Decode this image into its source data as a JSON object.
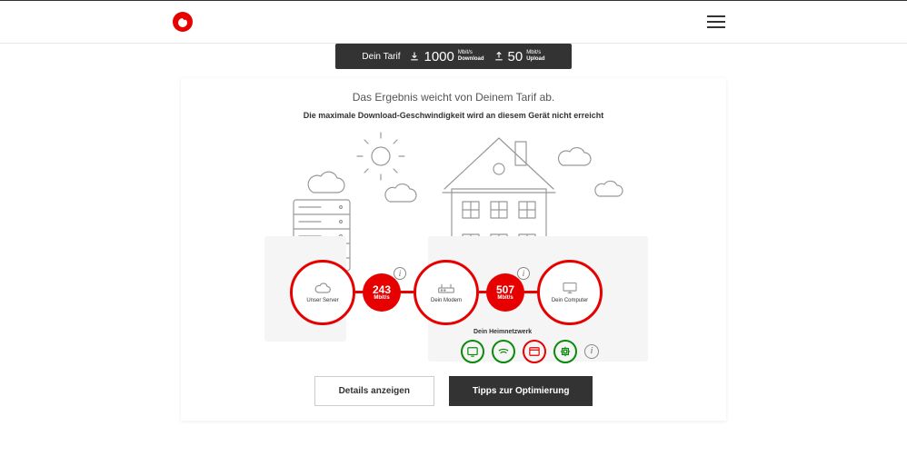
{
  "header": {
    "brand": "Vodafone"
  },
  "tarif": {
    "label": "Dein Tarif",
    "download_value": "1000",
    "download_unit": "Mbit/s",
    "download_label": "Download",
    "upload_value": "50",
    "upload_unit": "Mbit/s",
    "upload_label": "Upload"
  },
  "result": {
    "title": "Das Ergebnis weicht von Deinem Tarif ab.",
    "subtitle": "Die maximale Download-Geschwindigkeit wird an diesem Gerät nicht erreicht"
  },
  "nodes": {
    "server": {
      "label": "Unser Server"
    },
    "server_to_modem": {
      "value": "243",
      "unit": "Mbit/s"
    },
    "modem": {
      "label": "Dein Modem"
    },
    "modem_to_pc": {
      "value": "507",
      "unit": "Mbit/s"
    },
    "pc": {
      "label": "Dein Computer"
    }
  },
  "network_label": "Dein Heimnetzwerk",
  "buttons": {
    "details": "Details anzeigen",
    "tips": "Tipps zur Optimierung"
  }
}
